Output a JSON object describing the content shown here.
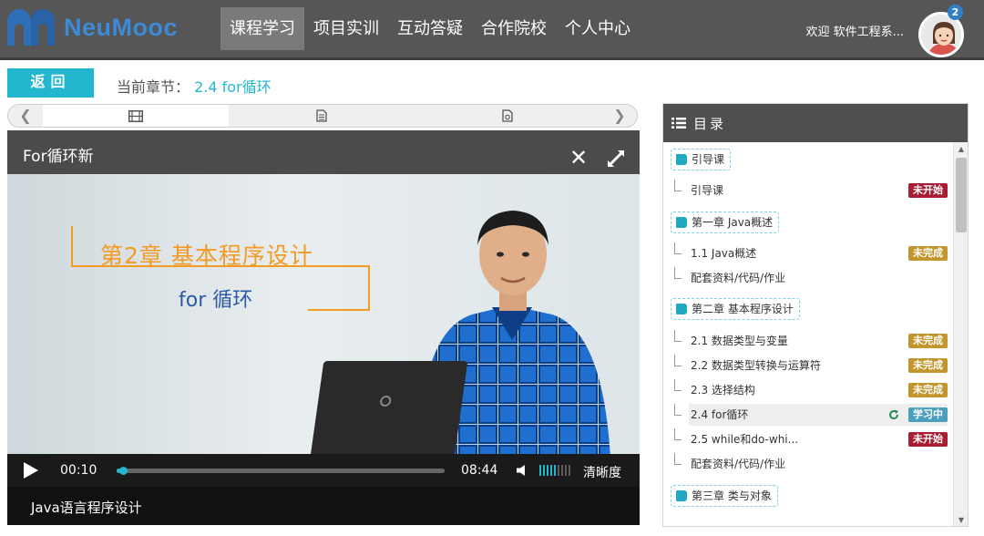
{
  "brand": {
    "name": "NeuMooc"
  },
  "nav": {
    "items": [
      {
        "label": "课程学习",
        "active": true
      },
      {
        "label": "项目实训",
        "active": false
      },
      {
        "label": "互动答疑",
        "active": false
      },
      {
        "label": "合作院校",
        "active": false
      },
      {
        "label": "个人中心",
        "active": false
      }
    ]
  },
  "user": {
    "welcome": "欢迎 软件工程系...",
    "badge": "2"
  },
  "subheader": {
    "back_label": "返回",
    "chapter_label": "当前章节：",
    "chapter_value": "2.4 for循环"
  },
  "resource_tabs": {
    "icons": [
      "film-icon",
      "document-icon",
      "attachment-icon"
    ]
  },
  "player": {
    "title": "For循环新",
    "slide_title": "第2章  基本程序设计",
    "slide_subtitle": "for 循环",
    "current_time": "00:10",
    "total_time": "08:44",
    "progress": 0.02,
    "volume": 0.6,
    "quality_label": "清晰度",
    "course_name": "Java语言程序设计"
  },
  "catalog": {
    "title": "目录",
    "chapters": [
      {
        "label": "引导课",
        "sections": [
          {
            "label": "引导课",
            "status": "未开始",
            "tag": "red"
          }
        ]
      },
      {
        "label": "第一章 Java概述",
        "sections": [
          {
            "label": "1.1 Java概述",
            "status": "未完成",
            "tag": "gold"
          },
          {
            "label": "配套资料/代码/作业",
            "status": "",
            "tag": ""
          }
        ]
      },
      {
        "label": "第二章 基本程序设计",
        "sections": [
          {
            "label": "2.1 数据类型与变量",
            "status": "未完成",
            "tag": "gold"
          },
          {
            "label": "2.2 数据类型转换与运算符",
            "status": "未完成",
            "tag": "gold"
          },
          {
            "label": "2.3 选择结构",
            "status": "未完成",
            "tag": "gold"
          },
          {
            "label": "2.4 for循环",
            "status": "学习中",
            "tag": "teal",
            "current": true
          },
          {
            "label": "2.5 while和do-whi...",
            "status": "未开始",
            "tag": "red"
          },
          {
            "label": "配套资料/代码/作业",
            "status": "",
            "tag": ""
          }
        ]
      },
      {
        "label": "第三章 类与对象",
        "sections": []
      }
    ]
  },
  "colors": {
    "accent": "#23b7cf",
    "header_bg": "#565656",
    "tag_red": "#a81d34",
    "tag_gold": "#c2962c",
    "tag_teal": "#4a9fbd",
    "slide_orange": "#f39b24",
    "slide_blue": "#2b5aa5"
  }
}
